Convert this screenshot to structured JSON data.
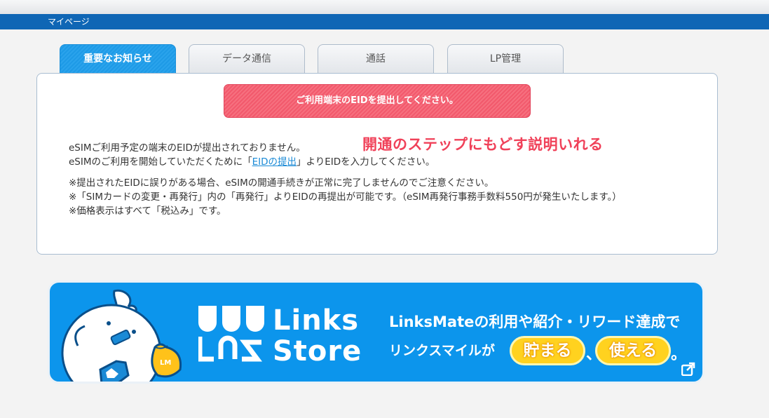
{
  "header": {
    "breadcrumb": "マイページ"
  },
  "tabs": [
    {
      "label": "重要なお知らせ",
      "active": true
    },
    {
      "label": "データ通信",
      "active": false
    },
    {
      "label": "通話",
      "active": false
    },
    {
      "label": "LP管理",
      "active": false
    }
  ],
  "notice": {
    "alert_button": "ご利用端末のEIDを提出してください。",
    "annotation": "開通のステップにもどす説明いれる",
    "line1": "eSIMご利用予定の端末のEIDが提出されておりません。",
    "line2_pre": "eSIMのご利用を開始していただくために「",
    "line2_link": "EIDの提出",
    "line2_post": "」よりEIDを入力してください。",
    "note1": "※提出されたEIDに誤りがある場合、eSIMの開通手続きが正常に完了しませんのでご注意ください。",
    "note2": "※「SIMカードの変更・再発行」内の「再発行」よりEIDの再提出が可能です。（eSIM再発行事務手数料550円が発生いたします。）",
    "note3": "※価格表示はすべて「税込み」です。"
  },
  "banner": {
    "logo_line1": "Links",
    "logo_line2": "Store",
    "promo_line1": "LinksMateの利用や紹介・リワード達成で",
    "promo_line2_pre": "リンクスマイルが",
    "pill1": "貯まる",
    "separator": "、",
    "pill2": "使える",
    "period": "。",
    "badge": "LM",
    "icon": "external-link-icon"
  },
  "colors": {
    "nav_blue": "#0f66b5",
    "tab_active": "#1e9ae6",
    "alert_pink": "#f2596c",
    "annotation_red": "#f04159",
    "banner_blue": "#0c95ec",
    "pill_yellow": "#ffd21f"
  }
}
